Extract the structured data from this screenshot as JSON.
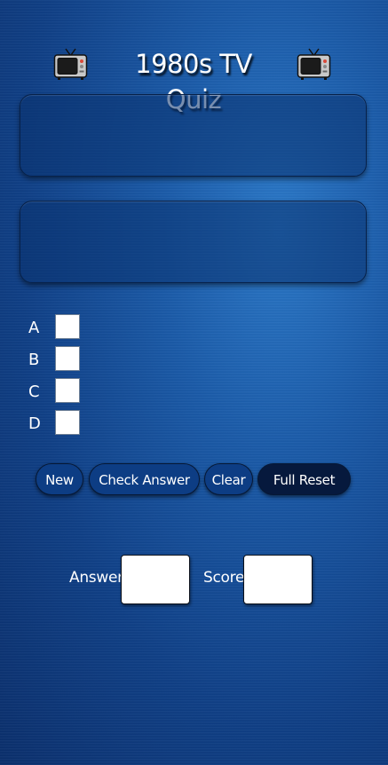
{
  "header": {
    "title": "1980s TV Quiz",
    "left_icon": "tv-icon",
    "right_icon": "tv-icon"
  },
  "question_panel": {
    "text": ""
  },
  "answers_panel": {
    "text": ""
  },
  "options": [
    {
      "letter": "A",
      "checked": false
    },
    {
      "letter": "B",
      "checked": false
    },
    {
      "letter": "C",
      "checked": false
    },
    {
      "letter": "D",
      "checked": false
    }
  ],
  "buttons": {
    "new_label": "New",
    "check_label": "Check Answer",
    "clear_label": "Clear",
    "reset_label": "Full Reset"
  },
  "readouts": {
    "answer_label": "Answer",
    "answer_value": "",
    "score_label": "Score",
    "score_value": ""
  },
  "colors": {
    "background": "#1a5aa8",
    "button": "#0d3d84",
    "reset_button": "#06193d",
    "text": "#ffffff"
  }
}
